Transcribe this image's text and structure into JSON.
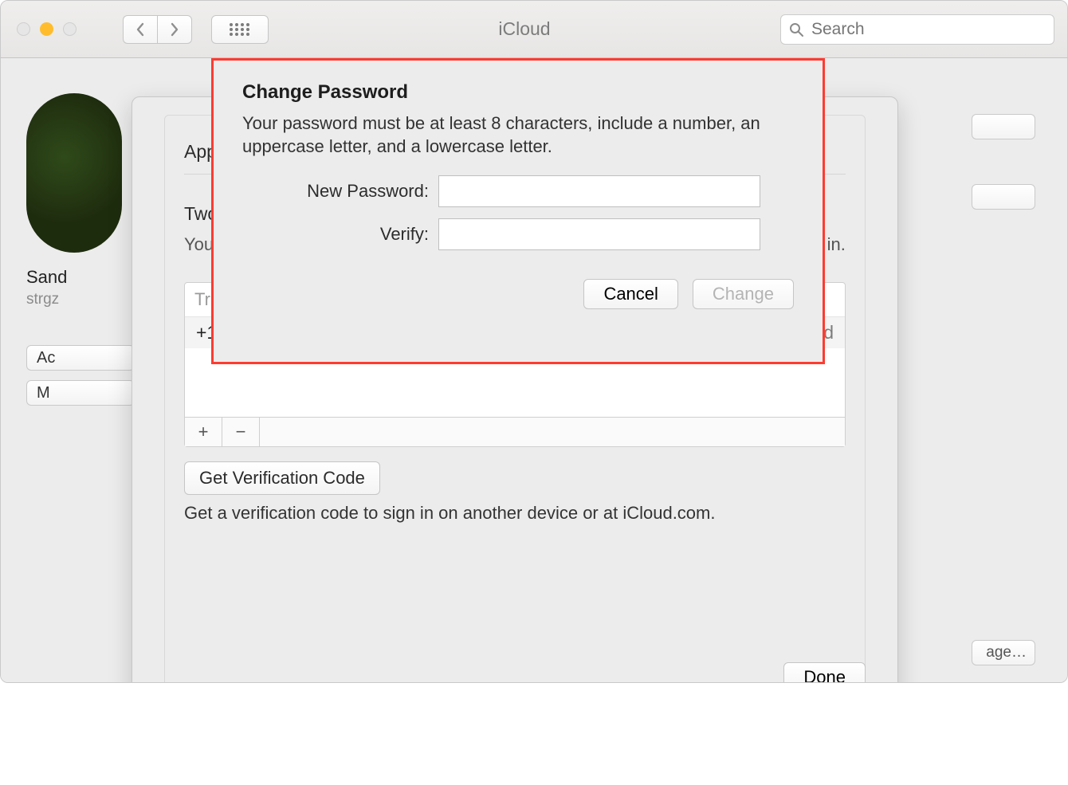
{
  "toolbar": {
    "title": "iCloud",
    "search_placeholder": "Search"
  },
  "sidebar": {
    "name": "Sand",
    "email": "strgz",
    "btn1": "Ac",
    "btn2": "M"
  },
  "background_right": {
    "btn3": "age…"
  },
  "security": {
    "apple_id_label": "Appl",
    "twofactor_label": "Two-",
    "twofactor_text_left": "Your t",
    "twofactor_text_right": "ning in.",
    "trusted_header": "Trusted Phone Numbers",
    "trusted_number": "+1",
    "trusted_status": "Verified",
    "add": "+",
    "remove": "−",
    "get_code_btn": "Get Verification Code",
    "get_code_text": "Get a verification code to sign in on another device or at iCloud.com.",
    "done": "Done"
  },
  "sheet": {
    "title": "Change Password",
    "description": "Your password must be at least 8 characters, include a number, an uppercase letter, and a lowercase letter.",
    "new_password_label": "New Password:",
    "verify_label": "Verify:",
    "cancel": "Cancel",
    "change": "Change"
  }
}
